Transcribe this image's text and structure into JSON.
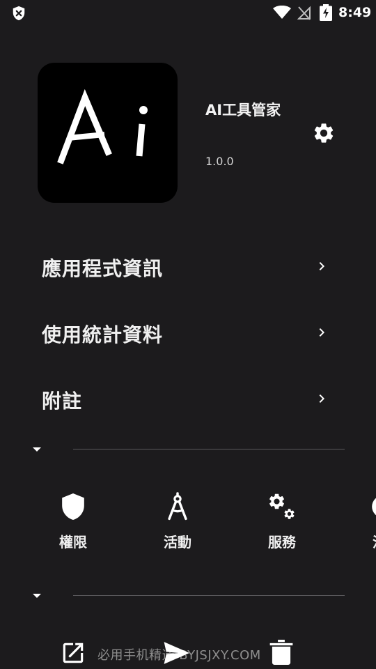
{
  "status_bar": {
    "time": "8:49",
    "icons": [
      "shield-x-icon",
      "wifi-icon",
      "no-signal-icon",
      "battery-charging-icon"
    ]
  },
  "app": {
    "name": "AI工具管家",
    "version": "1.0.0",
    "icon_text": "Ai"
  },
  "menu": {
    "items": [
      {
        "label": "應用程式資訊"
      },
      {
        "label": "使用統計資料"
      },
      {
        "label": "附註"
      }
    ]
  },
  "components": {
    "items": [
      {
        "label": "權限",
        "icon": "shield-icon"
      },
      {
        "label": "活動",
        "icon": "compass-icon"
      },
      {
        "label": "服務",
        "icon": "gears-icon"
      },
      {
        "label": "活",
        "icon": "circle-icon"
      }
    ]
  },
  "bottom_bar": {
    "watermark": "必用手机精选  BYJSJXY.COM",
    "icons": [
      "open-external-icon",
      "send-icon",
      "delete-icon"
    ]
  },
  "colors": {
    "background": "#1c1b1d",
    "text": "#ffffff",
    "divider": "#5a595c"
  }
}
